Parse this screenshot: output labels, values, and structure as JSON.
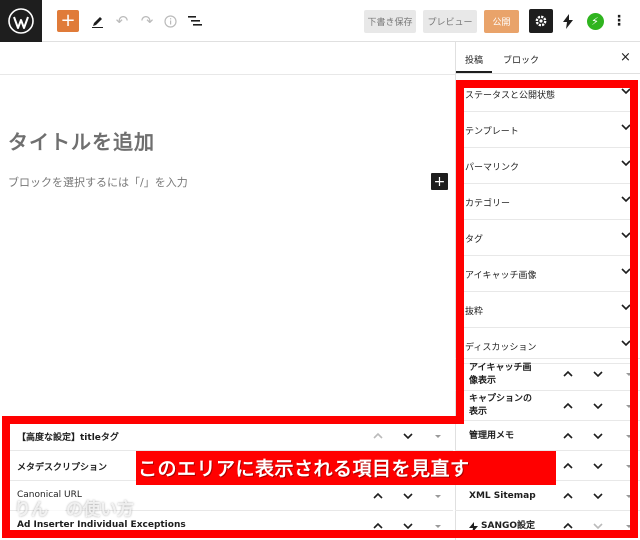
{
  "toolbar": {
    "add_block": "+",
    "draft_label": "下書き保存",
    "preview_label": "プレビュー",
    "publish_label": "公開"
  },
  "editor": {
    "title_placeholder": "タイトルを追加",
    "block_hint": "ブロックを選択するには「/」を入力",
    "inline_add": "+"
  },
  "sidebar": {
    "tab_post": "投稿",
    "tab_block": "ブロック",
    "close": "×",
    "panels": [
      "ステータスと公開状態",
      "テンプレート",
      "パーマリンク",
      "カテゴリー",
      "タグ",
      "アイキャッチ画像",
      "抜粋",
      "ディスカッション"
    ]
  },
  "meta_side": {
    "rows": [
      {
        "line1": "アイキャッチ画",
        "line2": "像表示"
      },
      {
        "line1": "キャプションの",
        "line2": "表示"
      },
      {
        "line1": "管理用メモ",
        "line2": ""
      },
      {
        "line1": "",
        "line2": ""
      },
      {
        "line1": "XML Sitemap",
        "line2": ""
      },
      {
        "line1": "SANGO設定",
        "line2": ""
      }
    ]
  },
  "meta_bottom": {
    "rows": [
      "【高度な設定】titleタグ",
      "メタデスクリプション",
      "Canonical URL",
      "Ad Inserter Individual Exceptions"
    ]
  },
  "annotation": {
    "callout": "このエリアに表示される項目を見直す",
    "watermark_left": "りん",
    "watermark_right": "の使い方",
    "frame_color": "#ff0000"
  }
}
